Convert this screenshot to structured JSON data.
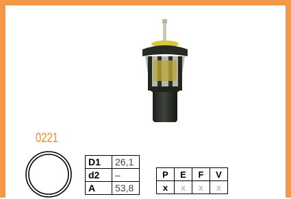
{
  "product": {
    "code": "0221",
    "image": "thermostat-housing"
  },
  "colors": {
    "frame": "#f39a4a",
    "code": "#f08a2e",
    "inactive": "#bdbdbd"
  },
  "dimensions": [
    {
      "label": "D1",
      "value": "26,1"
    },
    {
      "label": "d2",
      "value": "–"
    },
    {
      "label": "A",
      "value": "53,8"
    }
  ],
  "flags": {
    "headers": [
      "P",
      "E",
      "F",
      "V"
    ],
    "values": [
      "x",
      "x",
      "x",
      "x"
    ],
    "active": [
      true,
      false,
      false,
      false
    ]
  }
}
